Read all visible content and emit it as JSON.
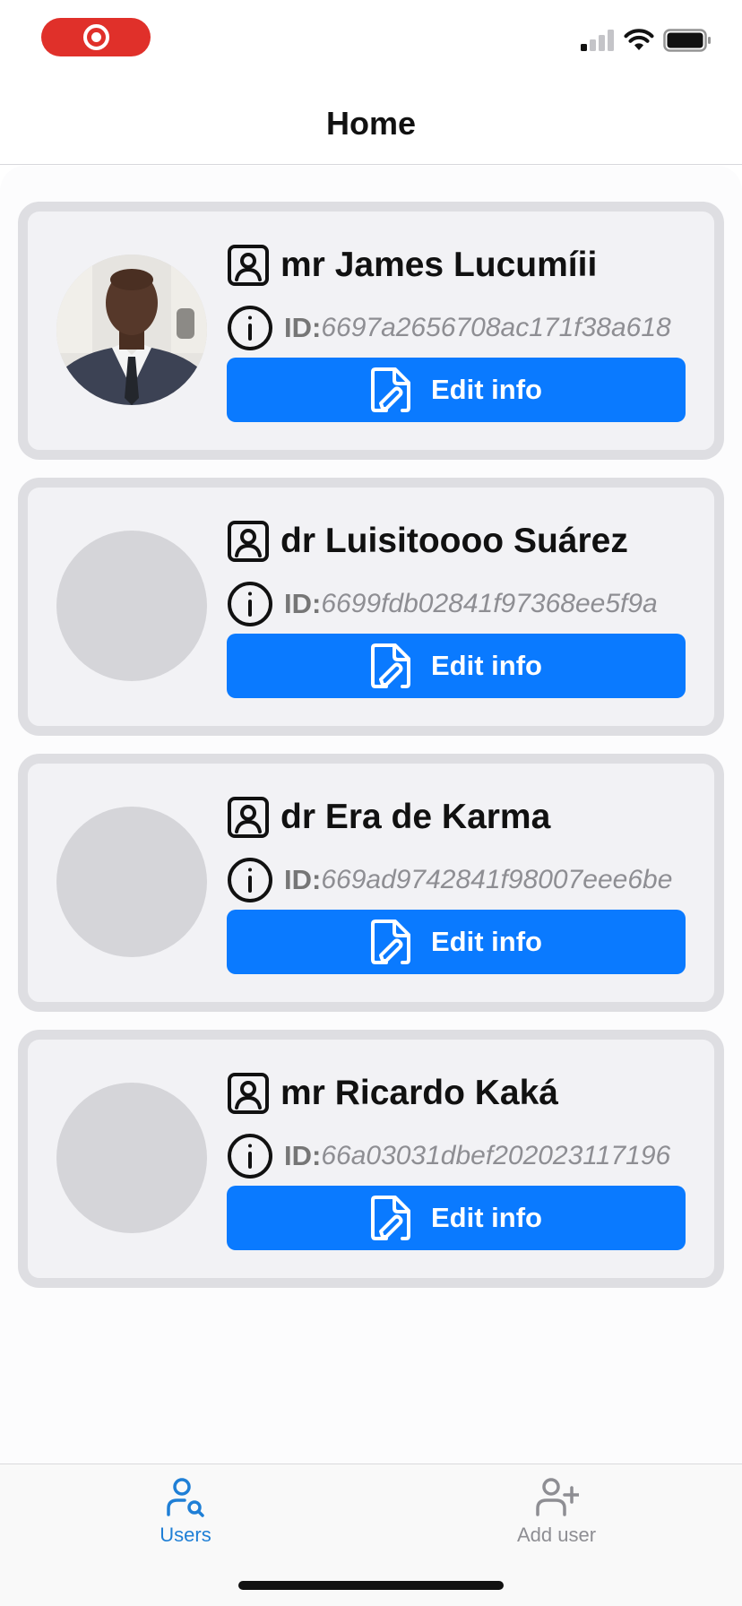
{
  "header": {
    "title": "Home"
  },
  "users": [
    {
      "name": "mr James Lucumíii",
      "id_label": "ID:",
      "id_value": "6697a2656708ac171f38a618",
      "edit_label": "Edit info",
      "has_photo": true
    },
    {
      "name": "dr Luisitoooo Suárez",
      "id_label": "ID:",
      "id_value": "6699fdb02841f97368ee5f9a",
      "edit_label": "Edit info",
      "has_photo": false
    },
    {
      "name": "dr Era de Karma",
      "id_label": "ID:",
      "id_value": "669ad9742841f98007eee6be",
      "edit_label": "Edit info",
      "has_photo": false
    },
    {
      "name": "mr Ricardo Kaká",
      "id_label": "ID:",
      "id_value": "66a03031dbef202023117196",
      "edit_label": "Edit info",
      "has_photo": false
    }
  ],
  "tabs": [
    {
      "label": "Users",
      "icon": "user-search-icon",
      "active": true
    },
    {
      "label": "Add user",
      "icon": "user-plus-icon",
      "active": false
    }
  ],
  "colors": {
    "accent": "#0a7aff",
    "tab_active": "#1f7fd6",
    "tab_inactive": "#8e8e93",
    "recording": "#e0302a"
  }
}
